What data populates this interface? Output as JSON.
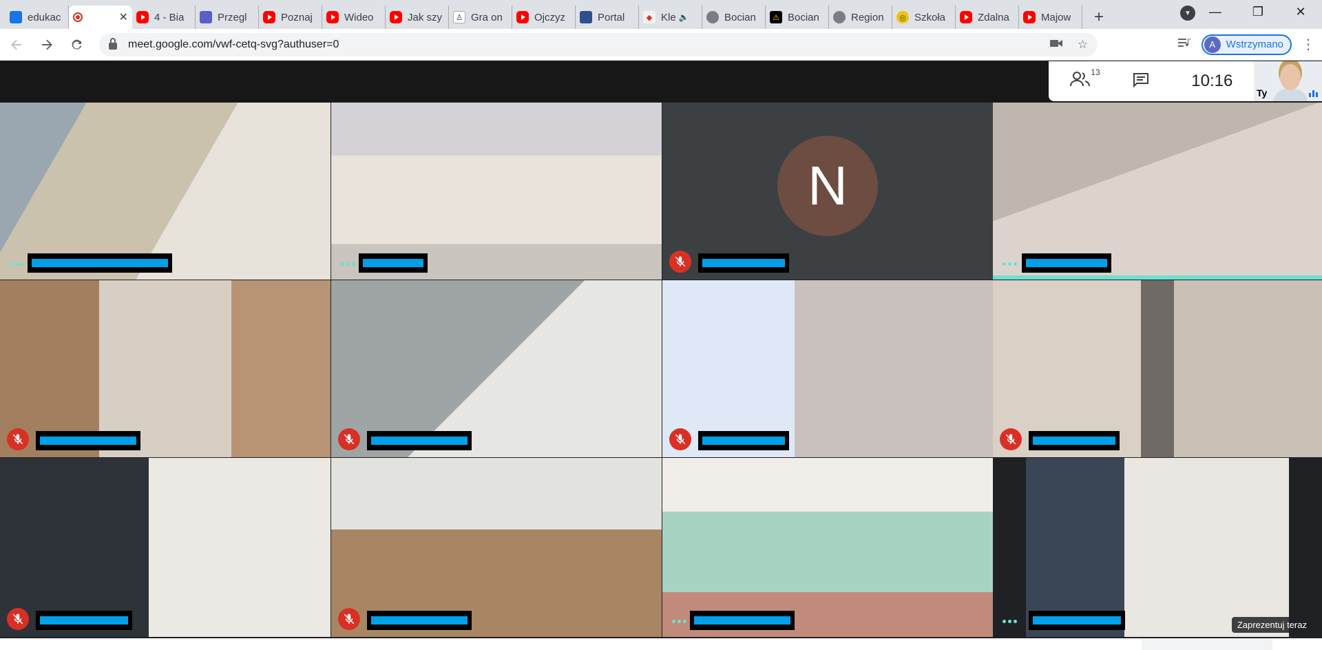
{
  "browser": {
    "tabs": [
      {
        "label": "edukac",
        "icon": "edu"
      },
      {
        "label": "",
        "icon": "meet",
        "active": true
      },
      {
        "label": "4 - Bia",
        "icon": "yt"
      },
      {
        "label": "Przegl",
        "icon": "teams"
      },
      {
        "label": "Poznaj",
        "icon": "yt"
      },
      {
        "label": "Wideo",
        "icon": "yt"
      },
      {
        "label": "Jak szy",
        "icon": "yt"
      },
      {
        "label": "Gra on",
        "icon": "gra"
      },
      {
        "label": "Ojczyz",
        "icon": "yt"
      },
      {
        "label": "Portal",
        "icon": "portal"
      },
      {
        "label": "Kle",
        "icon": "kle"
      },
      {
        "label": "Bocian",
        "icon": "globe"
      },
      {
        "label": "Bocian",
        "icon": "warn"
      },
      {
        "label": "Region",
        "icon": "globe"
      },
      {
        "label": "Szkoła",
        "icon": "school"
      },
      {
        "label": "Zdalna",
        "icon": "yt"
      },
      {
        "label": "Majow",
        "icon": "yt"
      }
    ],
    "new_tab": "+",
    "url": "meet.google.com/vwf-cetq-svg?authuser=0",
    "profile_initial": "A",
    "profile_status": "Wstrzymano",
    "window_controls": {
      "minimize": "—",
      "maximize": "❐",
      "close": "✕"
    }
  },
  "meet": {
    "participant_count": "13",
    "time": "10:16",
    "self_label": "Ty",
    "avatar_initial": "N",
    "present_now": "Zaprezentuj teraz"
  },
  "colors": {
    "mic_off": "#d93025",
    "name_redaction": "#00a0e9",
    "speaking_bar": "#6ee0d0",
    "avatar_bg": "#6d4c41"
  }
}
